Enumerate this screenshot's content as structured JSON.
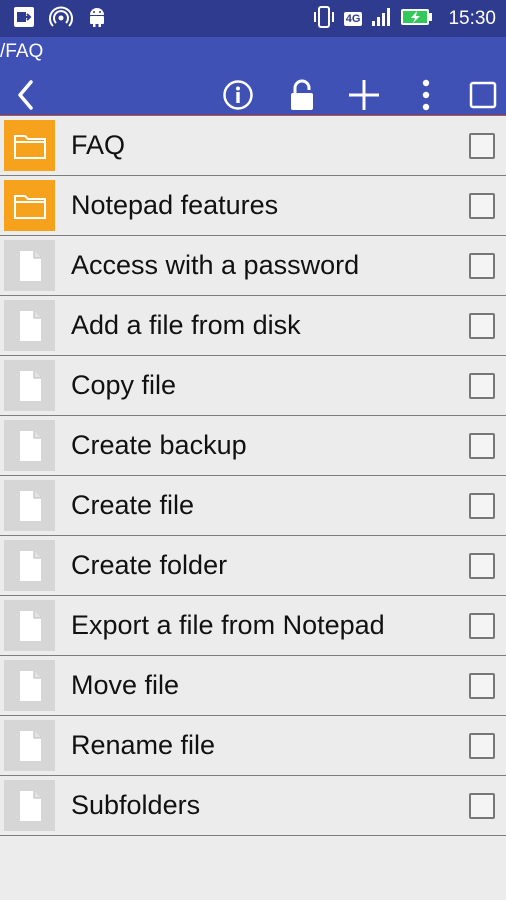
{
  "status_bar": {
    "network_badge": "4G",
    "time": "15:30",
    "icons": [
      "screen-mirror-icon",
      "hotspot-icon",
      "android-icon",
      "vibrate-icon",
      "signal-icon",
      "battery-charging-icon"
    ]
  },
  "app_bar": {
    "path": "/FAQ",
    "actions": [
      "back-icon",
      "info-icon",
      "lock-icon",
      "add-icon",
      "overflow-menu-icon",
      "select-all-checkbox"
    ]
  },
  "colors": {
    "status_bar": "#2f3b8f",
    "app_bar": "#3f51b5",
    "folder": "#f7a21c",
    "file_thumb": "#d6d6d6",
    "background": "#ececec"
  },
  "items": [
    {
      "type": "folder",
      "label": "FAQ"
    },
    {
      "type": "folder",
      "label": "Notepad features"
    },
    {
      "type": "file",
      "label": "Access with a password"
    },
    {
      "type": "file",
      "label": "Add a file from disk"
    },
    {
      "type": "file",
      "label": "Copy file"
    },
    {
      "type": "file",
      "label": "Create backup"
    },
    {
      "type": "file",
      "label": "Create file"
    },
    {
      "type": "file",
      "label": "Create folder"
    },
    {
      "type": "file",
      "label": "Export a file from Notepad"
    },
    {
      "type": "file",
      "label": "Move file"
    },
    {
      "type": "file",
      "label": "Rename file"
    },
    {
      "type": "file",
      "label": "Subfolders"
    }
  ]
}
